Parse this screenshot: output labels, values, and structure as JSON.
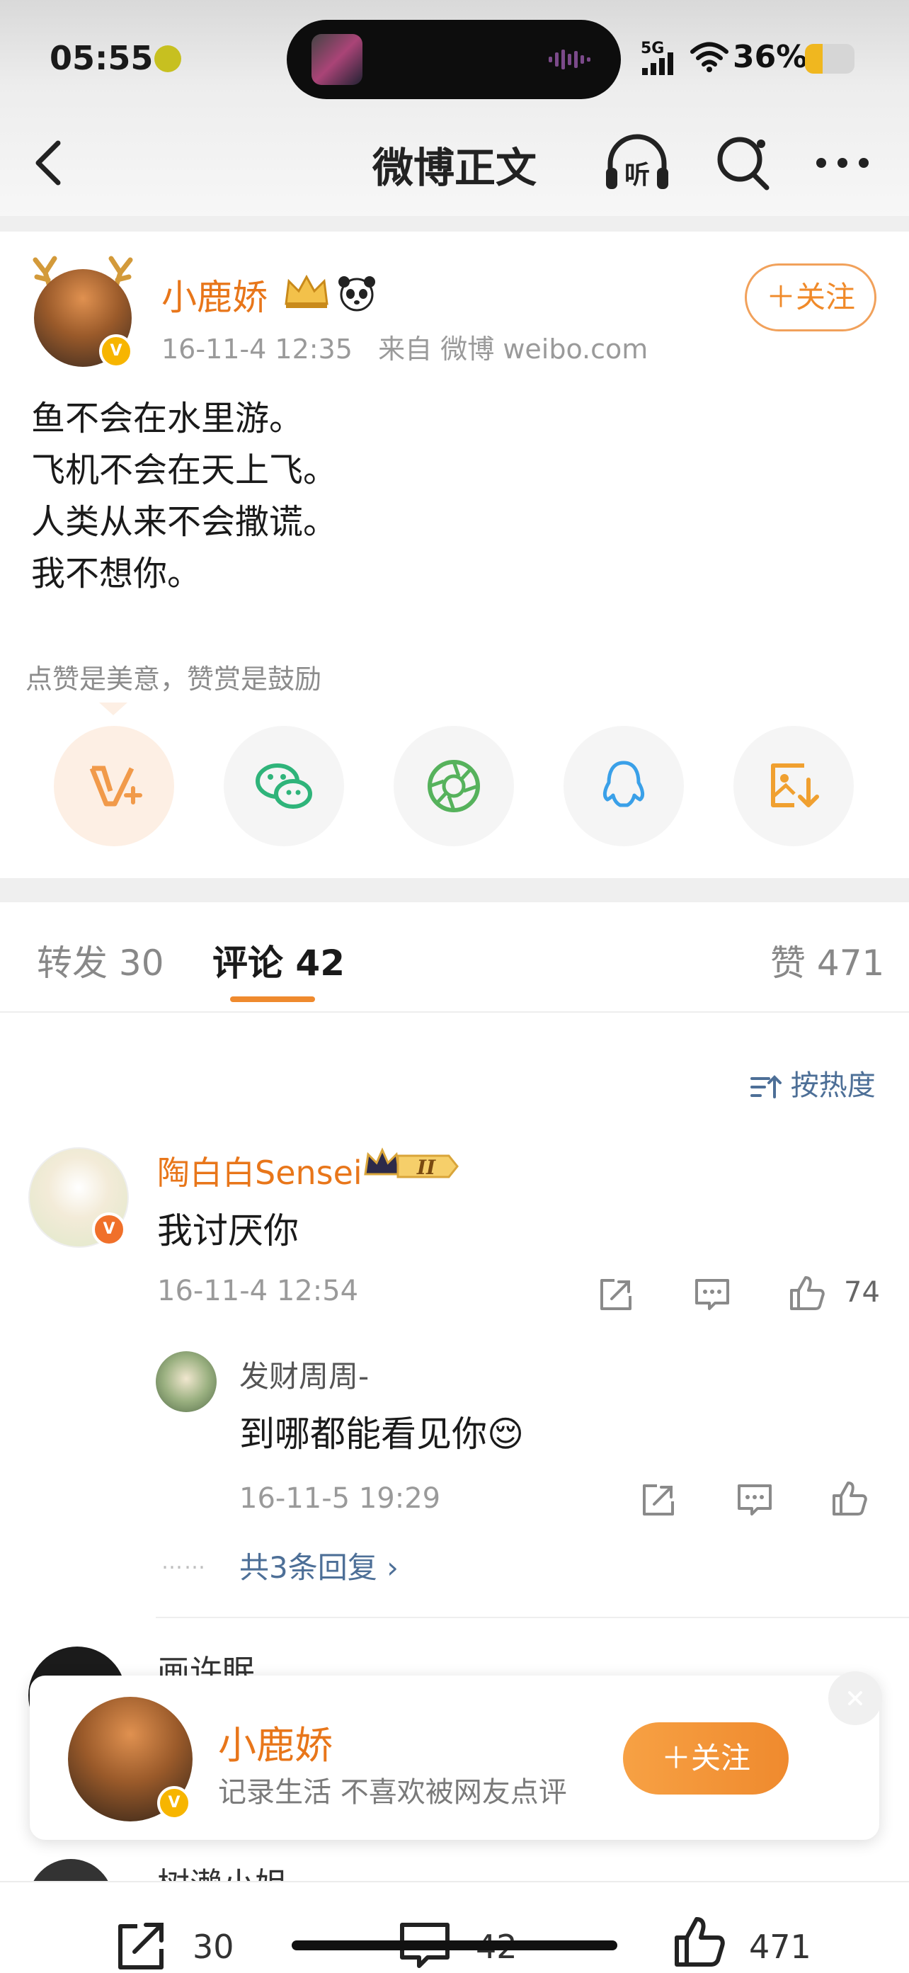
{
  "status_bar": {
    "time": "05:55",
    "network": "5G",
    "battery_percent": "36%",
    "battery_level": 0.36
  },
  "nav": {
    "title": "微博正文",
    "back_icon": "chevron-left-icon",
    "listen_label": "听",
    "search_icon": "search-icon",
    "more_icon": "more-icon"
  },
  "post": {
    "author": "小鹿娇",
    "timestamp": "16-11-4 12:35",
    "source": "来自 微博 weibo.com",
    "follow_label": "＋关注",
    "body_lines": [
      "鱼不会在水里游。",
      "飞机不会在天上飞。",
      "人类从来不会撒谎。",
      "我不想你。"
    ],
    "reward_hint": "点赞是美意，赞赏是鼓励",
    "share_icons": [
      "reward-v-icon",
      "wechat-icon",
      "moments-icon",
      "qq-icon",
      "save-image-icon"
    ]
  },
  "tabs": {
    "repost": "转发 30",
    "comments": "评论 42",
    "likes": "赞 471"
  },
  "sort_label": "按热度",
  "comment": {
    "author": "陶白白Sensei",
    "rank": "II",
    "text": "我讨厌你",
    "timestamp": "16-11-4 12:54",
    "likes": "74",
    "reply": {
      "author": "发财周周-",
      "text": "到哪都能看见你😌",
      "timestamp": "16-11-5 19:29"
    },
    "more_replies": "共3条回复 ›",
    "dots": "……"
  },
  "next_comment_author": "画许眠",
  "peek_comment_author": "树濑小姐",
  "follow_card": {
    "name": "小鹿娇",
    "bio": "记录生活 不喜欢被网友点评",
    "follow_label": "＋关注"
  },
  "toolbar": {
    "repost_count": "30",
    "comment_count": "42",
    "like_count": "471"
  },
  "colors": {
    "accent": "#ef8a2e",
    "name_orange": "#e8761a",
    "link_blue": "#4d6f97"
  }
}
